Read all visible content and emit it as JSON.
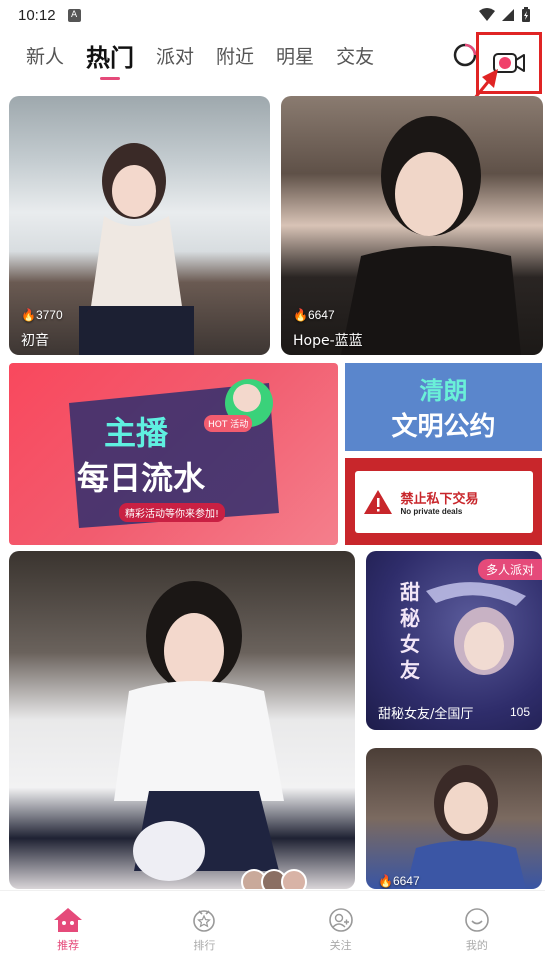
{
  "status": {
    "time": "10:12",
    "indicator": "A"
  },
  "tabs": [
    {
      "label": "新人"
    },
    {
      "label": "热门"
    },
    {
      "label": "派对"
    },
    {
      "label": "附近"
    },
    {
      "label": "明星"
    },
    {
      "label": "交友"
    }
  ],
  "active_tab": "热门",
  "feed": {
    "card1": {
      "heat": "3770",
      "name": "初音"
    },
    "card2": {
      "heat": "6647",
      "name": "Hope-蓝蓝"
    },
    "banner_main": {
      "badge": "HOT 活动",
      "line1": "主播",
      "line2": "每日流水",
      "subline": "精彩活动等你来参加!"
    },
    "banner_r1": {
      "line1": "清朗",
      "line2": "文明公约"
    },
    "banner_r2": {
      "title": "禁止私下交易",
      "subtitle": "No private deals"
    },
    "card4": {
      "tag": "多人派对",
      "art_text": "甜秘女友",
      "name": "甜秘女友/全国厅",
      "count": "105"
    },
    "card5": {
      "heat": "6647"
    }
  },
  "bottom_nav": [
    {
      "label": "推荐",
      "icon": "home-icon"
    },
    {
      "label": "排行",
      "icon": "ranking-icon"
    },
    {
      "label": "关注",
      "icon": "follow-icon"
    },
    {
      "label": "我的",
      "icon": "profile-icon"
    }
  ],
  "colors": {
    "accent": "#e54a7a",
    "highlight_box": "#e02424"
  }
}
